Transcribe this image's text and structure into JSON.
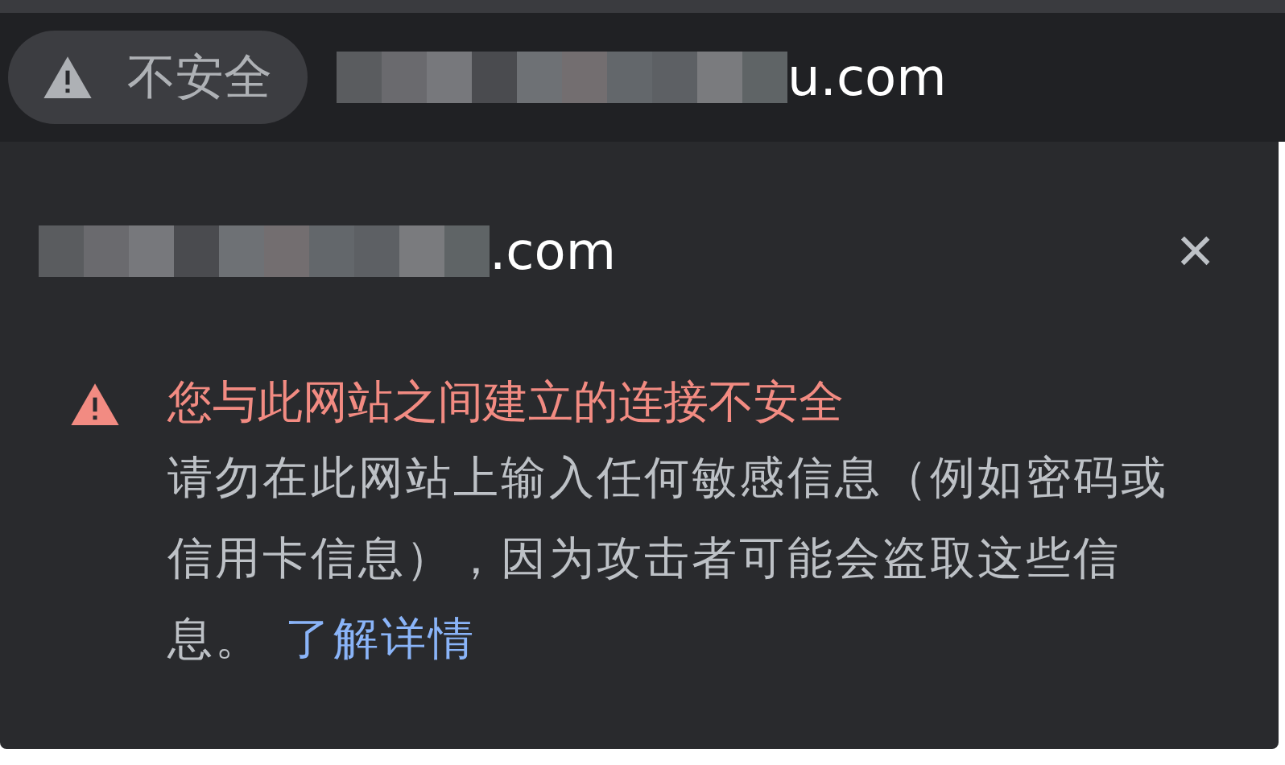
{
  "address_bar": {
    "security_chip": {
      "label": "不安全"
    },
    "url_visible": "u.com"
  },
  "popup": {
    "site_visible": ".com",
    "close": "×",
    "warning": {
      "title": "您与此网站之间建立的连接不安全",
      "body": "请勿在此网站上输入任何敏感信息（例如密码或信用卡信息），因为攻击者可能会盗取这些信息。",
      "link": "了解详情"
    }
  }
}
